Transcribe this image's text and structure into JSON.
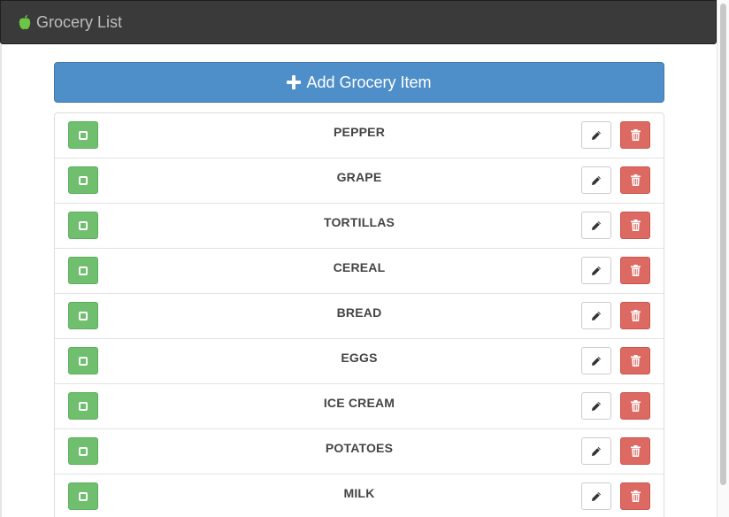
{
  "navbar": {
    "title": "Grocery List",
    "brand_icon": "apple-icon",
    "background": "#3a3a3a",
    "icon_color": "#6cc644"
  },
  "add_button": {
    "label": "Add Grocery Item",
    "icon": "plus-icon",
    "color": "#4f8fc9"
  },
  "items": [
    {
      "name": "PEPPER"
    },
    {
      "name": "GRAPE"
    },
    {
      "name": "TORTILLAS"
    },
    {
      "name": "CEREAL"
    },
    {
      "name": "BREAD"
    },
    {
      "name": "EGGS"
    },
    {
      "name": "ICE CREAM"
    },
    {
      "name": "POTATOES"
    },
    {
      "name": "MILK"
    }
  ],
  "row_actions": {
    "check_icon": "square-icon",
    "edit_icon": "pencil-icon",
    "delete_icon": "trash-icon",
    "check_color": "#6fbf6f",
    "delete_color": "#dc6a63"
  }
}
